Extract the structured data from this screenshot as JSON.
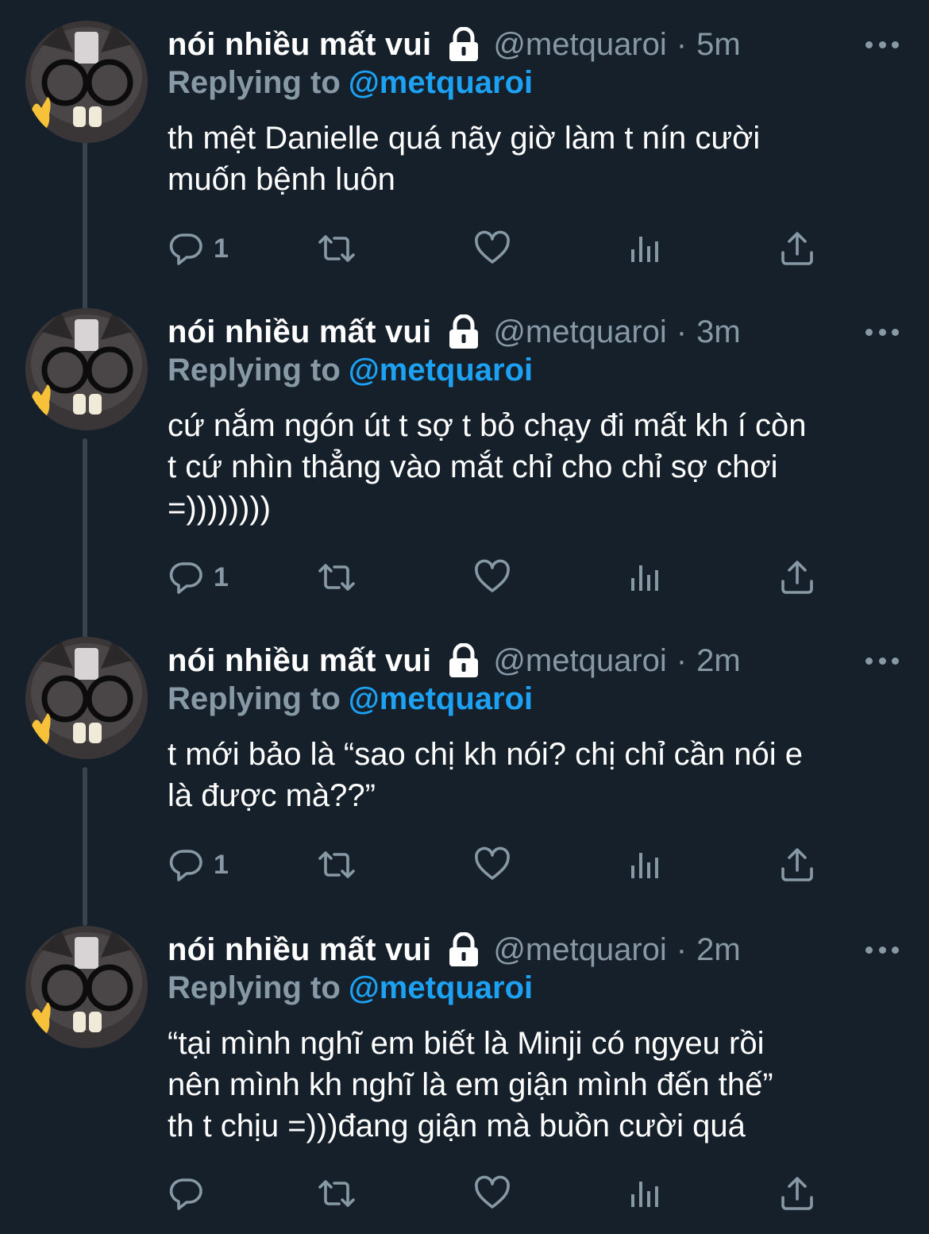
{
  "colors": {
    "background": "#15202b",
    "text": "#ffffff",
    "secondary": "#8899a6",
    "accent": "#1da1f2",
    "thread_line": "#38444d"
  },
  "tweets": [
    {
      "name": "nói nhiều mất vui",
      "handle": "@metquaroi",
      "separator": "·",
      "time": "5m",
      "replying_prefix": "Replying to",
      "replying_to": "@metquaroi",
      "text": "th mệt Danielle quá nãy giờ làm t nín cười\nmuốn bệnh luôn",
      "reply_count": "1",
      "icons": [
        "lock-icon",
        "more-icon",
        "reply-icon",
        "retweet-icon",
        "like-icon",
        "analytics-icon",
        "share-icon"
      ]
    },
    {
      "name": "nói nhiều mất vui",
      "handle": "@metquaroi",
      "separator": "·",
      "time": "3m",
      "replying_prefix": "Replying to",
      "replying_to": "@metquaroi",
      "text": "cứ nắm ngón út t sợ t bỏ chạy đi mất kh í còn\nt cứ nhìn thẳng vào mắt chỉ cho chỉ sợ chơi\n=))))))))",
      "reply_count": "1"
    },
    {
      "name": "nói nhiều mất vui",
      "handle": "@metquaroi",
      "separator": "·",
      "time": "2m",
      "replying_prefix": "Replying to",
      "replying_to": "@metquaroi",
      "text": "t mới bảo là “sao chị kh nói? chị chỉ cần nói e\nlà được mà??”",
      "reply_count": "1"
    },
    {
      "name": "nói nhiều mất vui",
      "handle": "@metquaroi",
      "separator": "·",
      "time": "2m",
      "replying_prefix": "Replying to",
      "replying_to": "@metquaroi",
      "text": "“tại mình nghĩ em biết là Minji có ngyeu rồi\nnên mình kh nghĩ là em giận mình đến thế”\nth t chịu =)))đang giận mà buồn cười quá",
      "reply_count": ""
    }
  ]
}
